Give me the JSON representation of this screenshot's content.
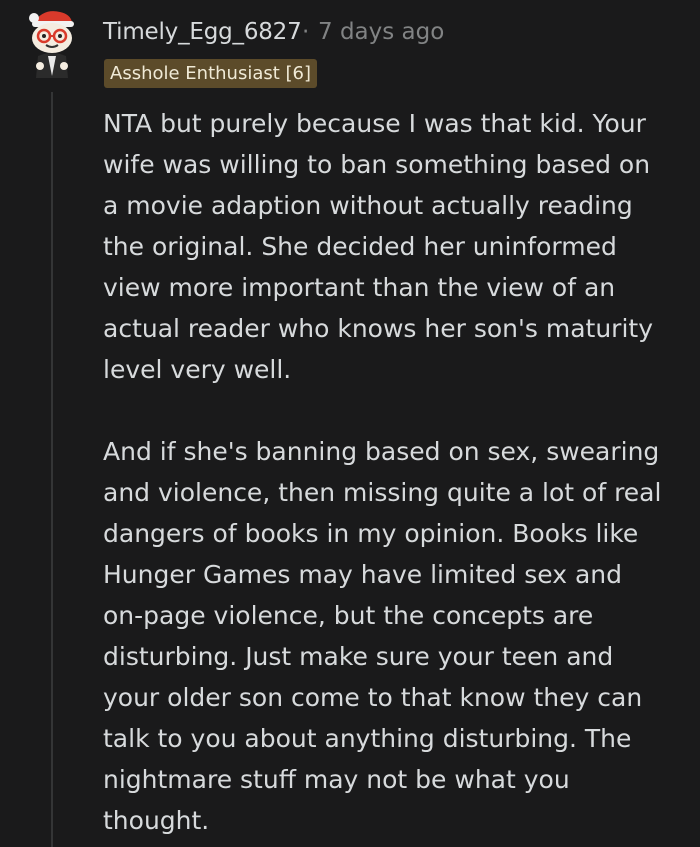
{
  "comment": {
    "username": "Timely_Egg_6827",
    "separator": "·",
    "timestamp": "7 days ago",
    "flair": "Asshole Enthusiast [6]",
    "paragraphs": [
      {
        "lines": [
          "NTA but purely because I was that kid. Your",
          "wife was willing to ban something based on",
          "a movie adaption without actually reading",
          "the original. She decided her uninformed",
          "view more important than the view of an",
          "actual reader who knows her son's maturity",
          "level very well."
        ]
      },
      {
        "lines": [
          "And if she's banning based on sex, swearing",
          "and violence, then missing quite a lot of real",
          "dangers of books in my opinion. Books like",
          "Hunger Games may have limited sex and",
          "on-page violence, but the concepts are",
          "disturbing. Just make sure your teen and",
          "your older son come to that know they can",
          "talk to you about anything disturbing. The",
          "nightmare stuff may not be what you",
          "thought."
        ]
      }
    ]
  },
  "colors": {
    "background": "#1a1a1b",
    "text": "#d7dadc",
    "meta": "#818384",
    "flair_bg": "#5c4b2a",
    "flair_text": "#f0ead6",
    "thread_line": "#343536"
  },
  "icons": {
    "avatar": "reddit-snoo-avatar-icon"
  }
}
